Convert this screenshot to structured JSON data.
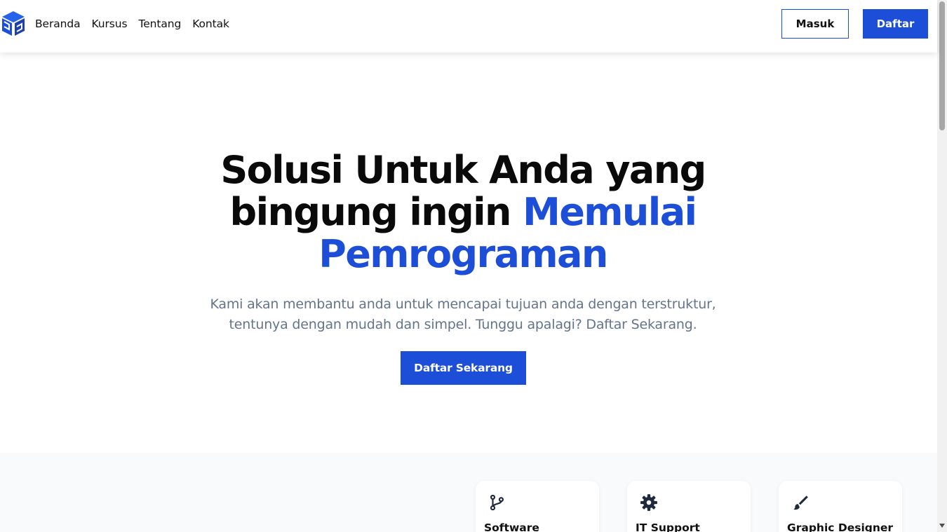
{
  "nav": {
    "logo_icon": "cube-logo-icon",
    "links": [
      "Beranda",
      "Kursus",
      "Tentang",
      "Kontak"
    ],
    "login_label": "Masuk",
    "register_label": "Daftar"
  },
  "hero": {
    "title_line1": "Solusi Untuk Anda yang",
    "title_line2_plain": "bingung ingin ",
    "title_line2_accent": "Memulai",
    "title_line3_accent": "Pemrograman",
    "subtitle_line1": "Kami akan membantu anda untuk mencapai tujuan anda dengan terstruktur,",
    "subtitle_line2": "tentunya dengan mudah dan simpel. Tunggu apalagi? Daftar Sekarang.",
    "cta_label": "Daftar Sekarang"
  },
  "courses": [
    {
      "title": "Software",
      "icon": "git-branch-icon"
    },
    {
      "title": "IT Support",
      "icon": "gear-icon"
    },
    {
      "title": "Graphic Designer",
      "icon": "paint-brush-icon"
    }
  ],
  "colors": {
    "accent": "#1d4ed8",
    "text": "#0a0a0a",
    "muted": "#64748b",
    "section_bg": "#f8fafc"
  }
}
